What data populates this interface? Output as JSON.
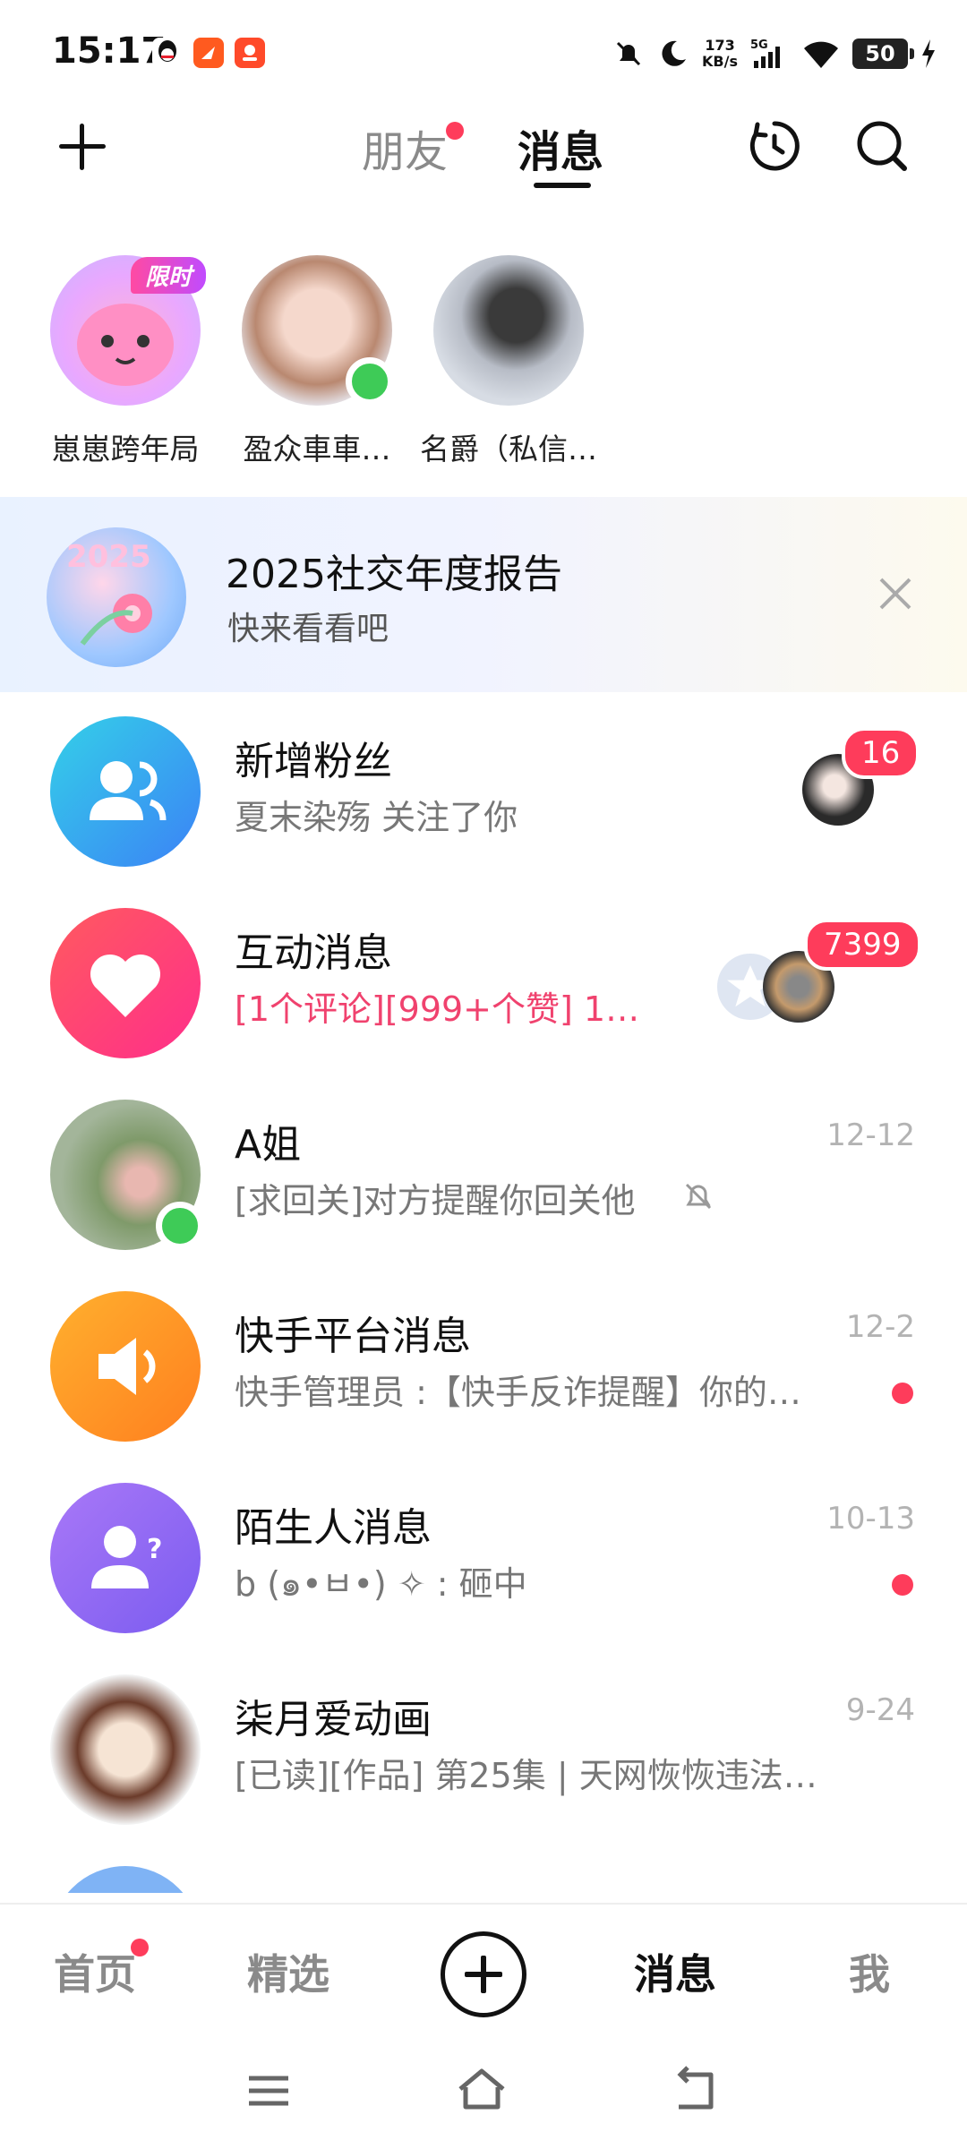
{
  "status_bar": {
    "time": "15:17",
    "network_speed_value": "173",
    "network_speed_unit": "KB/s",
    "network_type": "5G",
    "battery": "50",
    "icons": [
      "qq-icon",
      "app-orange-icon",
      "app-red-icon",
      "mute-icon",
      "moon-icon",
      "signal-icon",
      "wifi-icon",
      "battery-icon",
      "charging-icon"
    ]
  },
  "header": {
    "tabs": [
      {
        "label": "朋友",
        "active": false,
        "has_dot": true
      },
      {
        "label": "消息",
        "active": true
      }
    ]
  },
  "stories": [
    {
      "name": "崽崽跨年局",
      "badge": "限时"
    },
    {
      "name": "盈众車車…",
      "online": true
    },
    {
      "name": "名爵（私信…"
    }
  ],
  "banner": {
    "title": "2025社交年度报告",
    "subtitle": "快来看看吧"
  },
  "messages": [
    {
      "title": "新增粉丝",
      "preview": "夏末染殇 关注了你",
      "badge": "16",
      "icon": "followers-icon",
      "color": "#3ba8f0"
    },
    {
      "title": "互动消息",
      "preview": "[1个评论][999+个赞] 1…",
      "badge": "7399",
      "icon": "heart-icon",
      "color": "#ff3c6e"
    },
    {
      "title": "A姐",
      "preview": "[求回关]对方提醒你回关他",
      "time": "12-12",
      "muted": true,
      "online": true
    },
    {
      "title": "快手平台消息",
      "preview": "快手管理员 :【快手反诈提醒】你的…",
      "time": "12-2",
      "unread": true,
      "icon": "speaker-icon",
      "color": "#ff9a1f"
    },
    {
      "title": "陌生人消息",
      "preview": "b (๑•ㅂ•) ✧ : 砸中",
      "time": "10-13",
      "unread": true,
      "icon": "stranger-icon",
      "color": "#9a6bf0"
    },
    {
      "title": "柒月爱动画",
      "preview": "[已读][作品] 第25集 | 天网恢恢违法…",
      "time": "9-24"
    }
  ],
  "bottom_nav": {
    "items": [
      {
        "label": "首页",
        "has_dot": true
      },
      {
        "label": "精选"
      },
      {
        "label": "消息",
        "active": true
      },
      {
        "label": "我"
      }
    ]
  },
  "colors": {
    "accent_red": "#fe3c5b",
    "online_green": "#3ecb57",
    "preview_pink": "#f0426e"
  }
}
